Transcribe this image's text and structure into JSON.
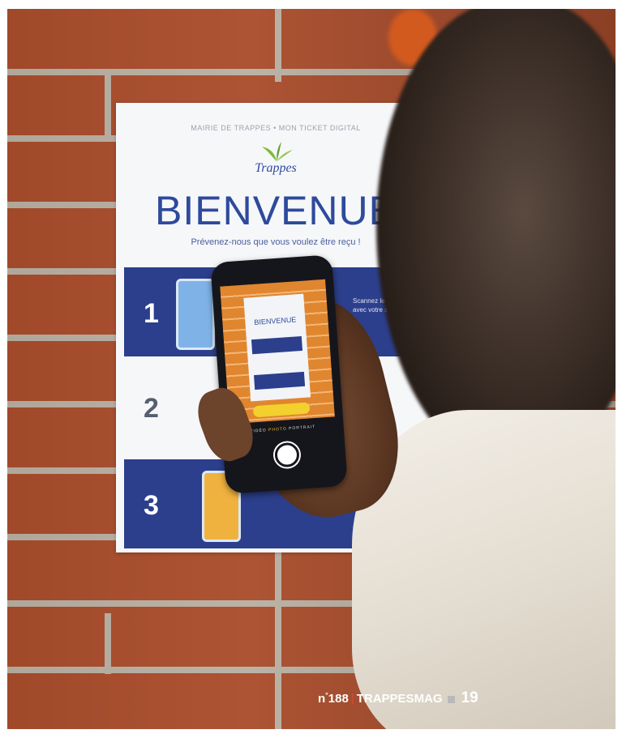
{
  "poster": {
    "top_line": "MAIRIE DE TRAPPES • MON TICKET DIGITAL",
    "logo": "Trappes",
    "title": "BIENVENUE",
    "subtitle": "Prévenez-nous que vous voulez être reçu !",
    "steps": [
      {
        "number": "1",
        "text": "Scannez le QR code avec votre smartphone"
      },
      {
        "number": "2",
        "text": ""
      },
      {
        "number": "3",
        "text": ""
      }
    ]
  },
  "phone_screen": {
    "mini_title": "BIENVENUE",
    "camera_modes": [
      "VIDÉO",
      "PHOTO",
      "PORTRAIT"
    ],
    "active_mode": "PHOTO"
  },
  "folio": {
    "prefix": "n",
    "degree": "°",
    "issue": "188",
    "separator": "|",
    "magazine": "TRAPPESMAG",
    "page": "19"
  },
  "colors": {
    "poster_blue": "#2c3f8c",
    "brick": "#a94d2c",
    "accent": "#d64a3a"
  }
}
